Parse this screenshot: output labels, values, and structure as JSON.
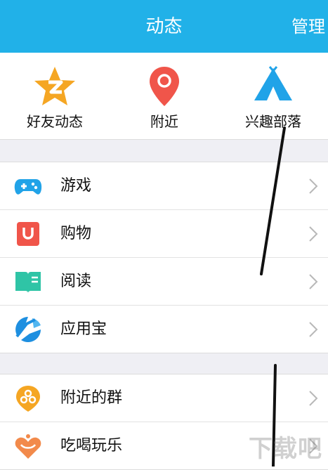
{
  "header": {
    "title": "动态",
    "manage_label": "管理"
  },
  "quick_links": [
    {
      "label": "好友动态",
      "icon": "qzone-star-icon",
      "color": "#f5a623"
    },
    {
      "label": "附近",
      "icon": "location-pin-icon",
      "color": "#f0554a"
    },
    {
      "label": "兴趣部落",
      "icon": "tent-icon",
      "color": "#21a3e8"
    }
  ],
  "list_group_1": [
    {
      "label": "游戏",
      "icon": "gamepad-icon",
      "color": "#21a3e8"
    },
    {
      "label": "购物",
      "icon": "shopping-bag-icon",
      "color": "#f0554a"
    },
    {
      "label": "阅读",
      "icon": "book-icon",
      "color": "#2fc4a6"
    },
    {
      "label": "应用宝",
      "icon": "app-store-icon",
      "color": "#1e8fe0"
    }
  ],
  "list_group_2": [
    {
      "label": "附近的群",
      "icon": "nearby-group-icon",
      "color": "#f5a623"
    },
    {
      "label": "吃喝玩乐",
      "icon": "food-heart-icon",
      "color": "#f28a4b"
    }
  ],
  "colors": {
    "header_bg": "#21b1e8",
    "page_bg": "#efeff4"
  },
  "watermark": "下载吧"
}
